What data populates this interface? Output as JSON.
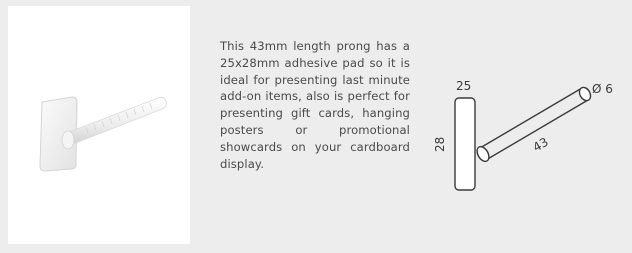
{
  "product": {
    "description": "This 43mm length prong has a 25x28mm adhesive pad so it is ideal for presenting last minute add-on items, also is perfect for presenting gift cards, hanging posters or promotional showcards on your cardboard display."
  },
  "diagram": {
    "width_label": "25",
    "height_label": "28",
    "length_label": "43",
    "diameter_label": "Ø 6"
  },
  "colors": {
    "background": "#ededed",
    "card": "#ffffff",
    "text": "#4a4a4a",
    "line": "#3a3a3a"
  }
}
